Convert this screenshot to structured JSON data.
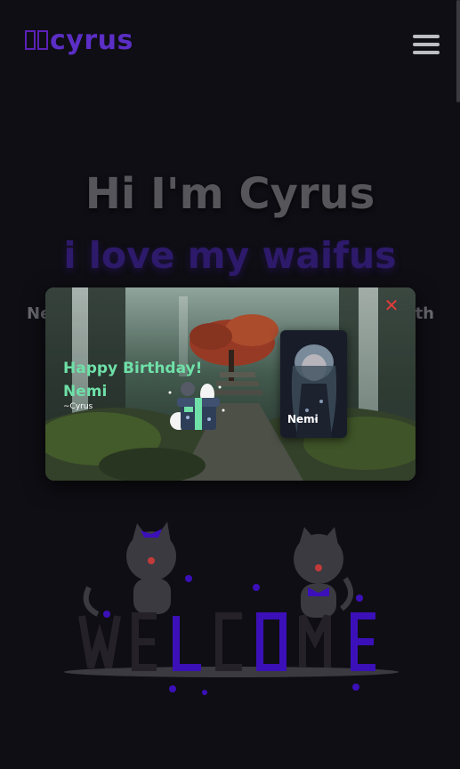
{
  "header": {
    "logo_text": "cyrus",
    "menu_icon": "hamburger-menu-icon"
  },
  "hero": {
    "title": "Hi I'm Cyrus",
    "subtitle": "i love my waifus",
    "line_left": "Ne",
    "line_right": "5th"
  },
  "popup": {
    "greeting_line1": "Happy Birthday!",
    "greeting_line2": "Nemi",
    "signature": "~Cyrus",
    "card_name": "Nemi",
    "close_icon": "close-icon",
    "gift_icon": "gift-box-icon"
  },
  "welcome": {
    "letters": [
      "W",
      "E",
      "L",
      "C",
      "O",
      "M",
      "E"
    ],
    "colors": {
      "dark": "#242228",
      "purple": "#3b10b8",
      "cat": "#3a3a40"
    }
  },
  "colors": {
    "background": "#0f0e14",
    "accent": "#5b2ec6",
    "close": "#e23b3b",
    "greeting": "#6fe0a8"
  }
}
